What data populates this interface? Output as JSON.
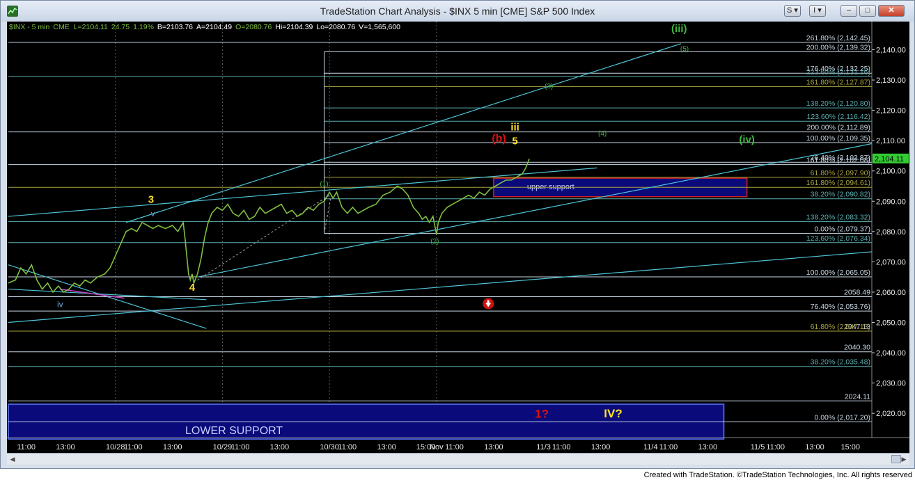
{
  "window": {
    "title": "TradeStation Chart Analysis - $INX 5 min [CME] S&P 500 Index",
    "buttons": {
      "s_label": "S",
      "i_label": "I",
      "minimize": "–",
      "maximize": "□",
      "close": "✕"
    }
  },
  "footer": "Created with TradeStation. ©TradeStation Technologies, Inc. All rights reserved",
  "colors": {
    "background": "#000000",
    "price": "#7fbf3f",
    "trend": "#4ec3d6",
    "fib_white": "#c9d9e6",
    "fib_teal": "#5aaeb0",
    "fib_olive": "#aaa23e",
    "wave_yellow": "#ffe02a",
    "wave_green": "#3fb93f",
    "wave_red": "#dd1111",
    "support_fill": "#0a0a7a",
    "support_border": "#cc2222",
    "price_tag": "#33cc33"
  },
  "status_bar": [
    {
      "text": "$INX - 5 min",
      "color": "#7fbf3f"
    },
    {
      "text": "CME",
      "color": "#7fbf3f"
    },
    {
      "text": "L=2104.11",
      "color": "#7fbf3f"
    },
    {
      "text": "24.75",
      "color": "#7fbf3f"
    },
    {
      "text": "1.19%",
      "color": "#7fbf3f"
    },
    {
      "text": "B=2103.76",
      "color": "#ffffff"
    },
    {
      "text": "A=2104.49",
      "color": "#ffffff"
    },
    {
      "text": "O=2080.76",
      "color": "#7fbf3f"
    },
    {
      "text": "Hi=2104.39",
      "color": "#ffffff"
    },
    {
      "text": "Lo=2080.76",
      "color": "#ffffff"
    },
    {
      "text": "V=1,565,600",
      "color": "#ffffff"
    }
  ],
  "chart_data": {
    "type": "line",
    "symbol": "$INX",
    "interval": "5 min",
    "ylim": [
      2012,
      2147
    ],
    "last_price": "2,104.11",
    "y_ticks": [
      {
        "v": 2140,
        "label": "2,140.00"
      },
      {
        "v": 2130,
        "label": "2,130.00"
      },
      {
        "v": 2120,
        "label": "2,120.00"
      },
      {
        "v": 2110,
        "label": "2,110.00"
      },
      {
        "v": 2100,
        "label": "2,100.00"
      },
      {
        "v": 2090,
        "label": "2,090.00"
      },
      {
        "v": 2080,
        "label": "2,080.00"
      },
      {
        "v": 2070,
        "label": "2,070.00"
      },
      {
        "v": 2060,
        "label": "2,060.00"
      },
      {
        "v": 2050,
        "label": "2,050.00"
      },
      {
        "v": 2040,
        "label": "2,040.00"
      },
      {
        "v": 2030,
        "label": "2,030.00"
      },
      {
        "v": 2020,
        "label": "2,020.00"
      }
    ],
    "x_ticks": [
      {
        "x": 0.5,
        "label": "11:00"
      },
      {
        "x": 1.6,
        "label": "13:00"
      },
      {
        "x": 3.0,
        "label": "10/28"
      },
      {
        "x": 3.5,
        "label": "11:00"
      },
      {
        "x": 4.6,
        "label": "13:00"
      },
      {
        "x": 6.0,
        "label": "10/29"
      },
      {
        "x": 6.5,
        "label": "11:00"
      },
      {
        "x": 7.6,
        "label": "13:00"
      },
      {
        "x": 9.0,
        "label": "10/30"
      },
      {
        "x": 9.5,
        "label": "11:00"
      },
      {
        "x": 10.6,
        "label": "13:00"
      },
      {
        "x": 11.7,
        "label": "15:00"
      },
      {
        "x": 12.0,
        "label": "Nov"
      },
      {
        "x": 12.5,
        "label": "11:00"
      },
      {
        "x": 13.6,
        "label": "13:00"
      },
      {
        "x": 15.0,
        "label": "11/3"
      },
      {
        "x": 15.5,
        "label": "11:00"
      },
      {
        "x": 16.6,
        "label": "13:00"
      },
      {
        "x": 18.0,
        "label": "11/4"
      },
      {
        "x": 18.5,
        "label": "11:00"
      },
      {
        "x": 19.6,
        "label": "13:00"
      },
      {
        "x": 21.0,
        "label": "11/5"
      },
      {
        "x": 21.5,
        "label": "11:00"
      },
      {
        "x": 22.6,
        "label": "13:00"
      },
      {
        "x": 23.6,
        "label": "15:00"
      }
    ],
    "x_range": [
      0,
      24.2
    ],
    "session_starts": [
      3.0,
      6.0,
      9.0,
      12.0
    ],
    "series": [
      {
        "points": [
          [
            0.0,
            2063
          ],
          [
            0.2,
            2064
          ],
          [
            0.35,
            2068
          ],
          [
            0.5,
            2066
          ],
          [
            0.65,
            2069
          ],
          [
            0.8,
            2064
          ],
          [
            0.95,
            2061
          ],
          [
            1.1,
            2063
          ],
          [
            1.25,
            2060
          ],
          [
            1.4,
            2062
          ],
          [
            1.55,
            2060
          ],
          [
            1.7,
            2061
          ],
          [
            1.85,
            2063
          ],
          [
            2.0,
            2062
          ],
          [
            2.15,
            2064
          ],
          [
            2.3,
            2063
          ],
          [
            2.5,
            2065
          ],
          [
            2.7,
            2066
          ],
          [
            2.85,
            2068
          ],
          [
            3.0,
            2072
          ],
          [
            3.15,
            2076
          ],
          [
            3.3,
            2080
          ],
          [
            3.45,
            2081
          ],
          [
            3.6,
            2080
          ],
          [
            3.75,
            2083
          ],
          [
            3.9,
            2082
          ],
          [
            4.05,
            2081
          ],
          [
            4.2,
            2082
          ],
          [
            4.4,
            2081
          ],
          [
            4.6,
            2082
          ],
          [
            4.75,
            2080
          ],
          [
            4.9,
            2083
          ],
          [
            4.95,
            2078
          ],
          [
            5.0,
            2072
          ],
          [
            5.05,
            2066
          ],
          [
            5.1,
            2064
          ],
          [
            5.15,
            2066
          ],
          [
            5.2,
            2063
          ],
          [
            5.3,
            2066
          ],
          [
            5.4,
            2071
          ],
          [
            5.5,
            2078
          ],
          [
            5.6,
            2083
          ],
          [
            5.7,
            2086
          ],
          [
            5.85,
            2088
          ],
          [
            6.0,
            2087
          ],
          [
            6.15,
            2089
          ],
          [
            6.3,
            2086
          ],
          [
            6.45,
            2085
          ],
          [
            6.6,
            2087
          ],
          [
            6.75,
            2084
          ],
          [
            6.9,
            2085
          ],
          [
            7.05,
            2088
          ],
          [
            7.2,
            2086
          ],
          [
            7.35,
            2087
          ],
          [
            7.5,
            2088
          ],
          [
            7.65,
            2089
          ],
          [
            7.8,
            2086
          ],
          [
            7.95,
            2087
          ],
          [
            8.1,
            2085
          ],
          [
            8.25,
            2086
          ],
          [
            8.4,
            2088
          ],
          [
            8.55,
            2087
          ],
          [
            8.7,
            2089
          ],
          [
            8.85,
            2090
          ],
          [
            9.0,
            2093
          ],
          [
            9.1,
            2091
          ],
          [
            9.2,
            2093
          ],
          [
            9.35,
            2088
          ],
          [
            9.5,
            2086
          ],
          [
            9.65,
            2088
          ],
          [
            9.8,
            2086
          ],
          [
            9.95,
            2087
          ],
          [
            10.1,
            2088
          ],
          [
            10.3,
            2089
          ],
          [
            10.5,
            2092
          ],
          [
            10.7,
            2093
          ],
          [
            10.9,
            2095
          ],
          [
            11.05,
            2094
          ],
          [
            11.2,
            2092
          ],
          [
            11.35,
            2088
          ],
          [
            11.5,
            2086
          ],
          [
            11.6,
            2084
          ],
          [
            11.7,
            2085
          ],
          [
            11.8,
            2083
          ],
          [
            11.9,
            2085
          ],
          [
            12.0,
            2079
          ],
          [
            12.05,
            2083
          ],
          [
            12.15,
            2086
          ],
          [
            12.3,
            2088
          ],
          [
            12.45,
            2089
          ],
          [
            12.6,
            2090
          ],
          [
            12.75,
            2091
          ],
          [
            12.9,
            2092
          ],
          [
            13.05,
            2091
          ],
          [
            13.2,
            2093
          ],
          [
            13.35,
            2092
          ],
          [
            13.5,
            2094
          ],
          [
            13.65,
            2095
          ],
          [
            13.8,
            2096
          ],
          [
            13.95,
            2097
          ],
          [
            14.1,
            2097
          ],
          [
            14.25,
            2098
          ],
          [
            14.4,
            2099
          ],
          [
            14.5,
            2101
          ],
          [
            14.6,
            2104
          ]
        ]
      }
    ],
    "fib_levels": [
      {
        "v": 2142.45,
        "label": "261.80% (2,142.45)",
        "color": "#c9d9e6",
        "x0": 0
      },
      {
        "v": 2139.32,
        "label": "200.00% (2,139.32)",
        "color": "#c9d9e6",
        "x0": 8.85
      },
      {
        "v": 2132.25,
        "label": "176.40% (2,132.25)",
        "color": "#c9d9e6",
        "x0": 8.85
      },
      {
        "v": 2131.16,
        "label": "223.60% (2,131.16)",
        "color": "#5aaeb0",
        "x0": 0
      },
      {
        "v": 2127.87,
        "label": "161.80% (2,127.87)",
        "color": "#aaa23e",
        "x0": 8.85
      },
      {
        "v": 2120.8,
        "label": "138.20% (2,120.80)",
        "color": "#5aaeb0",
        "x0": 8.85
      },
      {
        "v": 2116.42,
        "label": "123.60% (2,116.42)",
        "color": "#5aaeb0",
        "x0": 8.85
      },
      {
        "v": 2112.89,
        "label": "200.00% (2,112.89)",
        "color": "#c9d9e6",
        "x0": 0
      },
      {
        "v": 2109.35,
        "label": "100.00% (2,109.35)",
        "color": "#c9d9e6",
        "x0": 8.85
      },
      {
        "v": 2102.87,
        "label": "76.40% (2,102.87)",
        "color": "#c9d9e6",
        "x0": 8.85
      },
      {
        "v": 2102.08,
        "label": "161.80% (2,102.08)",
        "color": "#c9d9e6",
        "x0": 0
      },
      {
        "v": 2097.9,
        "label": "61.80% (2,097.90)",
        "color": "#aaa23e",
        "x0": 8.85
      },
      {
        "v": 2094.61,
        "label": "161.80% (2,094.61)",
        "color": "#aaa23e",
        "x0": 0
      },
      {
        "v": 2090.82,
        "label": "38.20% (2,090.82)",
        "color": "#5aaeb0",
        "x0": 8.85
      },
      {
        "v": 2083.32,
        "label": "138.20% (2,083.32)",
        "color": "#5aaeb0",
        "x0": 0
      },
      {
        "v": 2079.37,
        "label": "0.00% (2,079.37)",
        "color": "#c9d9e6",
        "x0": 8.85
      },
      {
        "v": 2076.34,
        "label": "123.60% (2,076.34)",
        "color": "#5aaeb0",
        "x0": 0
      },
      {
        "v": 2065.05,
        "label": "100.00% (2,065.05)",
        "color": "#c9d9e6",
        "x0": 0
      },
      {
        "v": 2058.49,
        "label": "2058.49",
        "color": "#c9d9e6",
        "x0": 0
      },
      {
        "v": 2053.76,
        "label": "76.40% (2,053.76)",
        "color": "#c9d9e6",
        "x0": 0
      },
      {
        "v": 2047.13,
        "label": "2047.13",
        "color": "#c9d9e6",
        "x0": 0
      },
      {
        "v": 2047.13,
        "label": "61.80% (2,047.13)",
        "color": "#aaa23e",
        "x0": 0
      },
      {
        "v": 2040.3,
        "label": "2040.30",
        "color": "#c9d9e6",
        "x0": 0
      },
      {
        "v": 2035.48,
        "label": "38.20% (2,035.48)",
        "color": "#5aaeb0",
        "x0": 0
      },
      {
        "v": 2024.11,
        "label": "2024.11",
        "color": "#c9d9e6",
        "x0": 0
      },
      {
        "v": 2017.2,
        "label": "0.00% (2,017.20)",
        "color": "#c9d9e6",
        "x0": 0
      }
    ],
    "trend_lines": [
      {
        "p1": [
          0.0,
          2061
        ],
        "p2": [
          5.55,
          2057.5
        ]
      },
      {
        "p1": [
          0.0,
          2050
        ],
        "p2": [
          24.2,
          2073.3
        ]
      },
      {
        "p1": [
          5.3,
          2065
        ],
        "p2": [
          24.2,
          2109
        ]
      },
      {
        "p1": [
          0.0,
          2085
        ],
        "p2": [
          16.5,
          2101
        ]
      },
      {
        "p1": [
          3.3,
          2083
        ],
        "p2": [
          18.85,
          2142
        ]
      },
      {
        "p1": [
          0.0,
          2069
        ],
        "p2": [
          5.55,
          2048
        ]
      }
    ],
    "dashed_lines": [
      {
        "p1": [
          5.3,
          2064
        ],
        "p2": [
          9.0,
          2092
        ],
        "color": "#aaaaaa"
      },
      {
        "p1": [
          8.85,
          2079.37
        ],
        "p2": [
          9.05,
          2092
        ],
        "color": "#aaaaaa"
      }
    ],
    "vertical_line": {
      "x": 8.85,
      "from": 2079.37,
      "to": 2139.32,
      "color": "#c9d9e6"
    },
    "magenta_line": {
      "p1": [
        1.45,
        2061
      ],
      "p2": [
        3.25,
        2058
      ],
      "color": "#cc44cc"
    },
    "support_zones": [
      {
        "label": "upper support",
        "x0": 13.6,
        "x1": 20.7,
        "y0": 2091.5,
        "y1": 2097.6,
        "font": 11
      },
      {
        "label": "LOWER SUPPORT",
        "x0": 0.0,
        "x1": 20.05,
        "y0": 2011.5,
        "y1": 2023,
        "font": 16
      }
    ],
    "wave_labels": [
      {
        "text": "3",
        "x": 4.0,
        "y": 2089.5,
        "color": "#ffe02a",
        "size": 15,
        "bold": true
      },
      {
        "text": "v",
        "x": 4.05,
        "y": 2085,
        "color": "#6fa8dc",
        "size": 11,
        "bold": false
      },
      {
        "text": "4",
        "x": 5.15,
        "y": 2060.5,
        "color": "#ffe02a",
        "size": 15,
        "bold": true
      },
      {
        "text": "iv",
        "x": 1.45,
        "y": 2055,
        "color": "#6fa8dc",
        "size": 12,
        "bold": false
      },
      {
        "text": "(1)",
        "x": 8.85,
        "y": 2095,
        "color": "#3fb93f",
        "size": 10,
        "bold": false
      },
      {
        "text": "(2)",
        "x": 11.95,
        "y": 2076,
        "color": "#3fb93f",
        "size": 10,
        "bold": false
      },
      {
        "text": "(3)",
        "x": 15.15,
        "y": 2127.3,
        "color": "#3fb93f",
        "size": 10,
        "bold": false
      },
      {
        "text": "(4)",
        "x": 16.65,
        "y": 2111.6,
        "color": "#3fb93f",
        "size": 10,
        "bold": false
      },
      {
        "text": "(5)",
        "x": 18.95,
        "y": 2139.5,
        "color": "#3fb93f",
        "size": 10,
        "bold": false
      },
      {
        "text": "(iii)",
        "x": 18.8,
        "y": 2145.8,
        "color": "#3fb93f",
        "size": 15,
        "bold": true
      },
      {
        "text": "(iv)",
        "x": 20.7,
        "y": 2109.2,
        "color": "#3fb93f",
        "size": 15,
        "bold": true
      },
      {
        "text": "(b)",
        "x": 13.75,
        "y": 2109.6,
        "color": "#dd1111",
        "size": 16,
        "bold": true
      },
      {
        "text": "iii",
        "x": 14.2,
        "y": 2113.4,
        "color": "#ffe02a",
        "size": 15,
        "bold": true
      },
      {
        "text": "5",
        "x": 14.2,
        "y": 2108.8,
        "color": "#ffe02a",
        "size": 15,
        "bold": true
      },
      {
        "text": "1?",
        "x": 14.95,
        "y": 2018.5,
        "color": "#dd1111",
        "size": 17,
        "bold": true
      },
      {
        "text": "IV?",
        "x": 16.95,
        "y": 2018.7,
        "color": "#ffe02a",
        "size": 17,
        "bold": true
      }
    ],
    "down_arrow": {
      "x": 13.45,
      "y": 2056.2
    }
  }
}
